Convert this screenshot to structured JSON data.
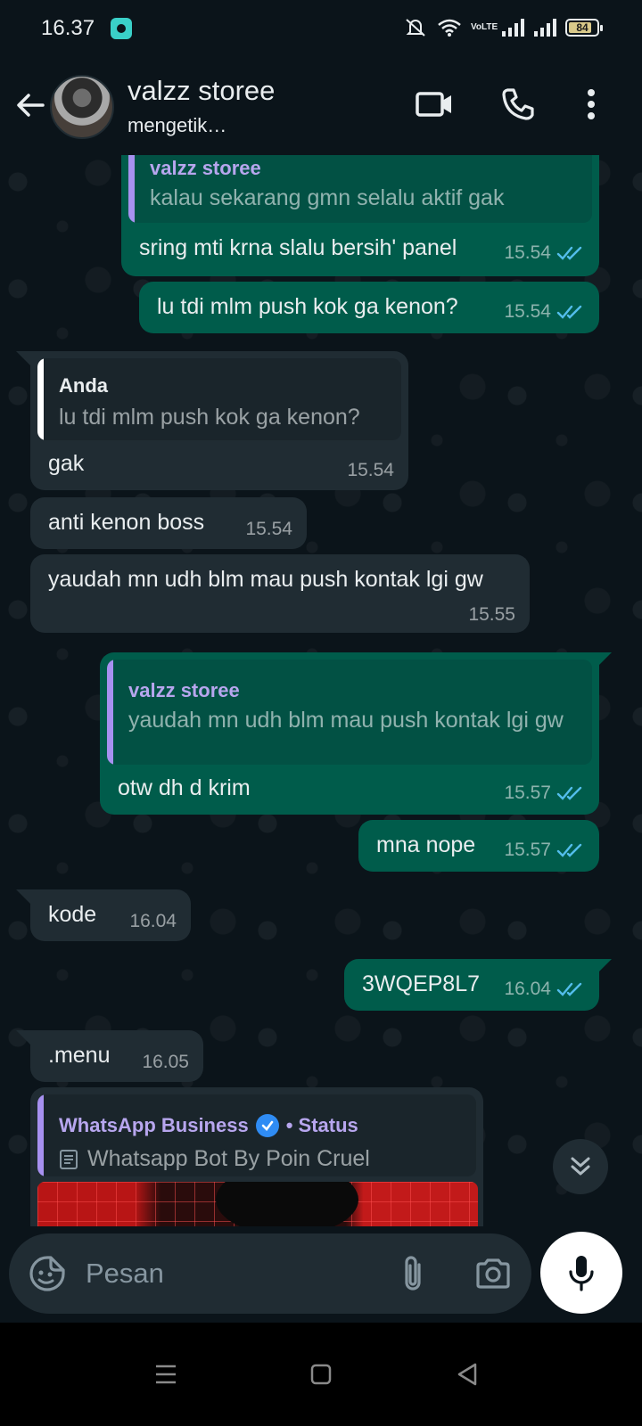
{
  "status_bar": {
    "time": "16.37",
    "network_label": "VoLTE",
    "battery": "84",
    "battery_fraction": 0.84
  },
  "header": {
    "contact_name": "valzz storee",
    "contact_status": "mengetik…",
    "icons": [
      "back-arrow-icon",
      "video-call-icon",
      "voice-call-icon",
      "more-options-icon"
    ]
  },
  "messages": [
    {
      "direction": "out",
      "quote": {
        "author": "valzz storee",
        "text": "kalau sekarang gmn selalu aktif gak"
      },
      "text": "sring mti krna slalu bersih' panel",
      "time": "15.54",
      "read": true
    },
    {
      "direction": "out",
      "text": "lu tdi mlm push kok ga kenon?",
      "time": "15.54",
      "read": true
    },
    {
      "direction": "in",
      "quote": {
        "author": "Anda",
        "text": "lu tdi mlm push kok ga kenon?"
      },
      "text": "gak",
      "time": "15.54"
    },
    {
      "direction": "in",
      "text": "anti kenon boss",
      "time": "15.54"
    },
    {
      "direction": "in",
      "text": "yaudah mn udh blm mau push kontak lgi gw",
      "time": "15.55"
    },
    {
      "direction": "out",
      "quote": {
        "author": "valzz storee",
        "text": "yaudah mn udh blm mau push kontak lgi gw"
      },
      "text": "otw dh d krim",
      "time": "15.57",
      "read": true
    },
    {
      "direction": "out",
      "text": "mna nope",
      "time": "15.57",
      "read": true
    },
    {
      "direction": "in",
      "text": "kode",
      "time": "16.04"
    },
    {
      "direction": "out",
      "text": "3WQEP8L7",
      "time": "16.04",
      "read": true
    },
    {
      "direction": "in",
      "text": ".menu",
      "time": "16.05"
    },
    {
      "direction": "in",
      "status_reply": {
        "author": "WhatsApp Business",
        "label": "• Status",
        "text": "Whatsapp Bot By Poin Cruel"
      }
    }
  ],
  "composer": {
    "placeholder": "Pesan",
    "icons": [
      "sticker-icon",
      "attach-icon",
      "camera-icon",
      "mic-icon"
    ]
  },
  "colors": {
    "outgoing_bubble": "#005c4b",
    "incoming_bubble": "#202c33",
    "background": "#0b141a",
    "read_tick": "#53bdeb",
    "quote_purple": "#a791f0",
    "quote_white": "#ffffff"
  }
}
